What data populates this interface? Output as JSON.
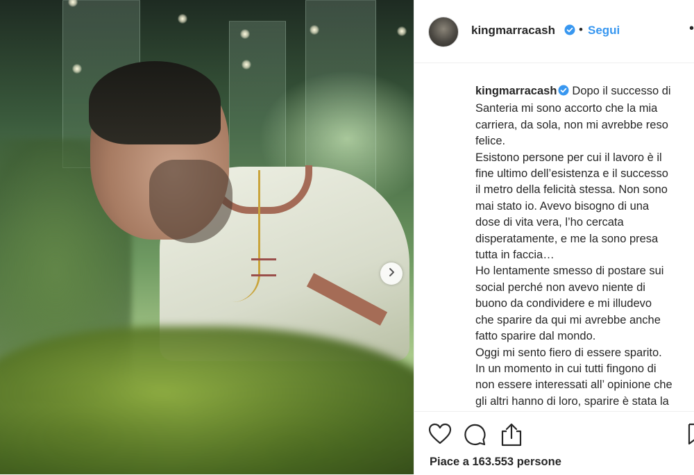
{
  "post": {
    "username": "kingmarracash",
    "follow_label": "Segui",
    "separator": "•",
    "more_label": "•"
  },
  "caption": {
    "username": "kingmarracash",
    "lines": [
      "Dopo il successo di",
      "Santeria mi sono accorto che la mia",
      "carriera, da sola, non mi avrebbe reso",
      "felice.",
      "Esistono persone per cui il lavoro è il",
      "fine ultimo dell’esistenza e il successo",
      "il metro della felicità stessa. Non sono",
      "mai stato io. Avevo bisogno di una",
      "dose di vita vera, l’ho cercata",
      "disperatamente, e me la sono presa",
      "tutta in faccia…",
      "Ho lentamente smesso di postare sui",
      "social perché non avevo niente di",
      "buono da condividere e mi illudevo",
      "che sparire da qui mi avrebbe anche",
      "fatto sparire dal mondo.",
      "Oggi mi sento fiero di essere sparito.",
      "In un momento in cui tutti fingono di",
      "non essere interessati all’ opinione che",
      "gli altri hanno di loro, sparire è stata la"
    ]
  },
  "likes_text": "Piace a 163.553 persone",
  "icons": {
    "verified": "verified-badge-icon",
    "next": "chevron-right-icon",
    "like": "heart-icon",
    "comment": "comment-icon",
    "share": "share-icon",
    "save": "bookmark-icon"
  },
  "colors": {
    "accent": "#3897f0",
    "text": "#262626",
    "border": "#efefef"
  }
}
